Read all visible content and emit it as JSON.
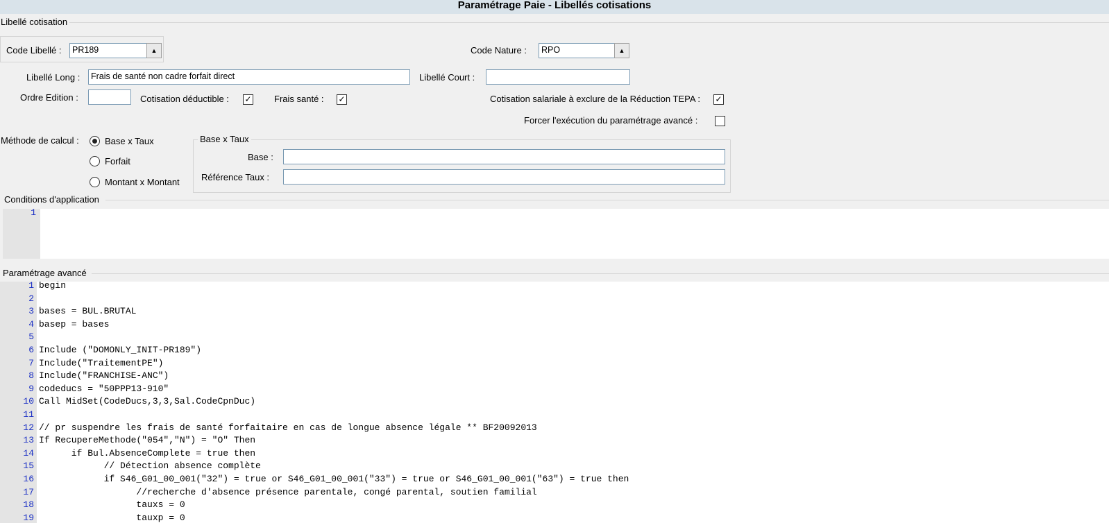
{
  "window": {
    "title": "Paramétrage Paie - Libellés cotisations"
  },
  "section_libelle": {
    "title": "Libellé cotisation"
  },
  "code_libelle": {
    "label": "Code Libellé :",
    "value": "PR189"
  },
  "code_nature": {
    "label": "Code Nature :",
    "value": "RPO"
  },
  "libelle_long": {
    "label": "Libellé Long :",
    "value": "Frais de santé non cadre forfait direct"
  },
  "libelle_court": {
    "label": "Libellé Court :",
    "value": ""
  },
  "ordre_edition": {
    "label": "Ordre Edition :",
    "value": ""
  },
  "cotisation_deductible": {
    "label": "Cotisation déductible :",
    "checked": true
  },
  "frais_sante": {
    "label": "Frais santé :",
    "checked": true
  },
  "tepa": {
    "label": "Cotisation salariale à exclure de la Réduction TEPA :",
    "checked": true
  },
  "forcer": {
    "label": "Forcer l'exécution du paramétrage avancé :",
    "checked": false
  },
  "methode": {
    "label": "Méthode de calcul :",
    "options": [
      "Base x Taux",
      "Forfait",
      "Montant x Montant"
    ],
    "selected": "Base x Taux"
  },
  "base_taux_group": {
    "title": "Base x Taux",
    "base_label": "Base :",
    "base_value": "",
    "ref_taux_label": "Référence Taux :",
    "ref_taux_value": ""
  },
  "conditions": {
    "title": "Conditions d'application",
    "lines": [
      ""
    ]
  },
  "parametrage_avance": {
    "title": "Paramétrage avancé",
    "lines": [
      "begin",
      "",
      "bases = BUL.BRUTAL",
      "basep = bases",
      "",
      "Include (\"DOMONLY_INIT-PR189\")",
      "Include(\"TraitementPE\")",
      "Include(\"FRANCHISE-ANC\")",
      "codeducs = \"50PPP13-910\"",
      "Call MidSet(CodeDucs,3,3,Sal.CodeCpnDuc)",
      "",
      "// pr suspendre les frais de santé forfaitaire en cas de longue absence légale ** BF20092013",
      "If RecupereMethode(\"054\",\"N\") = \"O\" Then",
      "      if Bul.AbsenceComplete = true then",
      "            // Détection absence complète",
      "            if S46_G01_00_001(\"32\") = true or S46_G01_00_001(\"33\") = true or S46_G01_00_001(\"63\") = true then",
      "                  //recherche d'absence présence parentale, congé parental, soutien familial",
      "                  tauxs = 0",
      "                  tauxp = 0"
    ]
  }
}
